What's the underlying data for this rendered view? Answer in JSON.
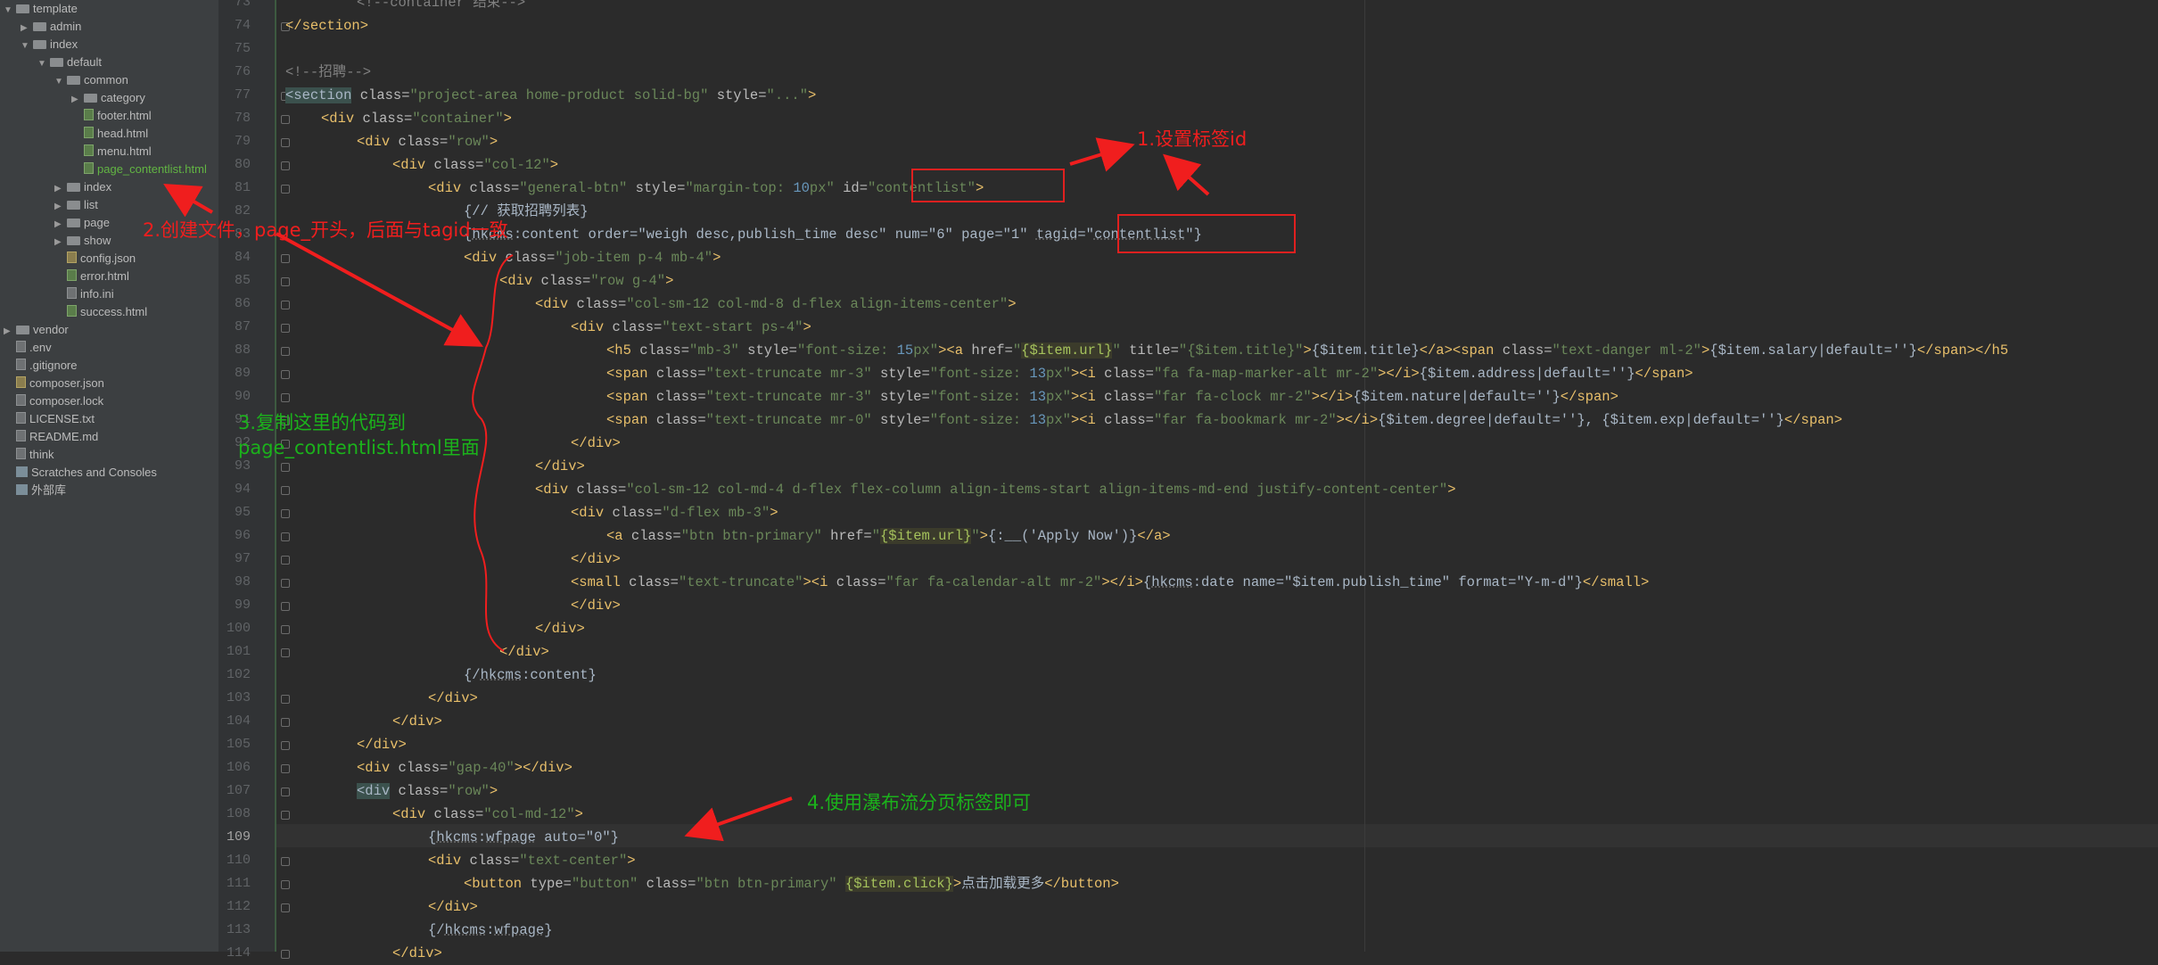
{
  "project_tree": [
    {
      "depth": 0,
      "arrow": "▼",
      "icon": "folder",
      "label": "template"
    },
    {
      "depth": 1,
      "arrow": "▶",
      "icon": "folder",
      "label": "admin"
    },
    {
      "depth": 1,
      "arrow": "▼",
      "icon": "folder",
      "label": "index"
    },
    {
      "depth": 2,
      "arrow": "▼",
      "icon": "folder",
      "label": "default"
    },
    {
      "depth": 3,
      "arrow": "▼",
      "icon": "folder",
      "label": "common"
    },
    {
      "depth": 4,
      "arrow": "▶",
      "icon": "folder",
      "label": "category"
    },
    {
      "depth": 4,
      "arrow": "",
      "icon": "html",
      "label": "footer.html"
    },
    {
      "depth": 4,
      "arrow": "",
      "icon": "html",
      "label": "head.html"
    },
    {
      "depth": 4,
      "arrow": "",
      "icon": "html",
      "label": "menu.html"
    },
    {
      "depth": 4,
      "arrow": "",
      "icon": "html",
      "label": "page_contentlist.html",
      "highlight": true
    },
    {
      "depth": 3,
      "arrow": "▶",
      "icon": "folder",
      "label": "index"
    },
    {
      "depth": 3,
      "arrow": "▶",
      "icon": "folder",
      "label": "list"
    },
    {
      "depth": 3,
      "arrow": "▶",
      "icon": "folder",
      "label": "page"
    },
    {
      "depth": 3,
      "arrow": "▶",
      "icon": "folder",
      "label": "show"
    },
    {
      "depth": 3,
      "arrow": "",
      "icon": "json",
      "label": "config.json"
    },
    {
      "depth": 3,
      "arrow": "",
      "icon": "html",
      "label": "error.html"
    },
    {
      "depth": 3,
      "arrow": "",
      "icon": "file",
      "label": "info.ini"
    },
    {
      "depth": 3,
      "arrow": "",
      "icon": "html",
      "label": "success.html"
    },
    {
      "depth": 0,
      "arrow": "▶",
      "icon": "folder",
      "label": "vendor"
    },
    {
      "depth": 0,
      "arrow": "",
      "icon": "file",
      "label": ".env"
    },
    {
      "depth": 0,
      "arrow": "",
      "icon": "file",
      "label": ".gitignore"
    },
    {
      "depth": 0,
      "arrow": "",
      "icon": "json",
      "label": "composer.json"
    },
    {
      "depth": 0,
      "arrow": "",
      "icon": "file",
      "label": "composer.lock"
    },
    {
      "depth": 0,
      "arrow": "",
      "icon": "file",
      "label": "LICENSE.txt"
    },
    {
      "depth": 0,
      "arrow": "",
      "icon": "file",
      "label": "README.md"
    },
    {
      "depth": 0,
      "arrow": "",
      "icon": "file",
      "label": "think"
    },
    {
      "depth": -1,
      "arrow": "",
      "icon": "ext",
      "label": "Scratches and Consoles"
    },
    {
      "depth": -1,
      "arrow": "",
      "icon": "ext",
      "label": "外部库"
    }
  ],
  "current_line": 109,
  "code_lines": [
    {
      "n": 73,
      "indent": 2,
      "tokens": [
        [
          "cm",
          "<!--container 结束-->"
        ]
      ]
    },
    {
      "n": 74,
      "indent": 0,
      "tokens": [
        [
          "tag",
          "</section>"
        ]
      ]
    },
    {
      "n": 75,
      "indent": 0,
      "tokens": []
    },
    {
      "n": 76,
      "indent": 0,
      "tokens": [
        [
          "cm",
          "<!--招聘-->"
        ]
      ]
    },
    {
      "n": 77,
      "indent": 0,
      "tokens": [
        [
          "hltag",
          "<section"
        ],
        [
          "attr",
          " class="
        ],
        [
          "val",
          "\"project-area home-product solid-bg\""
        ],
        [
          "attr",
          " style="
        ],
        [
          "val",
          "\"...\""
        ],
        [
          "tag",
          ">"
        ]
      ]
    },
    {
      "n": 78,
      "indent": 1,
      "tokens": [
        [
          "tag",
          "<div"
        ],
        [
          "attr",
          " class="
        ],
        [
          "val",
          "\"container\""
        ],
        [
          "tag",
          ">"
        ]
      ]
    },
    {
      "n": 79,
      "indent": 2,
      "tokens": [
        [
          "tag",
          "<div"
        ],
        [
          "attr",
          " class="
        ],
        [
          "val",
          "\"row\""
        ],
        [
          "tag",
          ">"
        ]
      ]
    },
    {
      "n": 80,
      "indent": 3,
      "tokens": [
        [
          "tag",
          "<div"
        ],
        [
          "attr",
          " class="
        ],
        [
          "val",
          "\"col-12\""
        ],
        [
          "tag",
          ">"
        ]
      ]
    },
    {
      "n": 81,
      "indent": 4,
      "tokens": [
        [
          "tag",
          "<div"
        ],
        [
          "attr",
          " class="
        ],
        [
          "val",
          "\"general-btn\""
        ],
        [
          "attr",
          " style="
        ],
        [
          "val",
          "\"margin-top: "
        ],
        [
          "num",
          "10"
        ],
        [
          "val",
          "px\""
        ],
        [
          "attr",
          " id="
        ],
        [
          "val",
          "\"contentlist\""
        ],
        [
          "tag",
          ">"
        ]
      ]
    },
    {
      "n": 82,
      "indent": 5,
      "tokens": [
        [
          "txt",
          "{// 获取招聘列表}"
        ]
      ]
    },
    {
      "n": 83,
      "indent": 5,
      "tokens": [
        [
          "txt",
          "{"
        ],
        [
          "ns",
          "hkcms"
        ],
        [
          "txt",
          ":content order=\"weigh desc,publish_time desc\" num=\"6\" page=\"1\" "
        ],
        [
          "ns",
          "tagid"
        ],
        [
          "txt",
          "=\""
        ],
        [
          "ns",
          "contentlist"
        ],
        [
          "txt",
          "\"}"
        ]
      ]
    },
    {
      "n": 84,
      "indent": 5,
      "tokens": [
        [
          "tag",
          "<div"
        ],
        [
          "attr",
          " class="
        ],
        [
          "val",
          "\"job-item p-4 mb-4\""
        ],
        [
          "tag",
          ">"
        ]
      ]
    },
    {
      "n": 85,
      "indent": 6,
      "tokens": [
        [
          "tag",
          "<div"
        ],
        [
          "attr",
          " class="
        ],
        [
          "val",
          "\"row g-4\""
        ],
        [
          "tag",
          ">"
        ]
      ]
    },
    {
      "n": 86,
      "indent": 7,
      "tokens": [
        [
          "tag",
          "<div"
        ],
        [
          "attr",
          " class="
        ],
        [
          "val",
          "\"col-sm-12 col-md-8 d-flex align-items-center\""
        ],
        [
          "tag",
          ">"
        ]
      ]
    },
    {
      "n": 87,
      "indent": 8,
      "tokens": [
        [
          "tag",
          "<div"
        ],
        [
          "attr",
          " class="
        ],
        [
          "val",
          "\"text-start ps-4\""
        ],
        [
          "tag",
          ">"
        ]
      ]
    },
    {
      "n": 88,
      "indent": 9,
      "tokens": [
        [
          "tag",
          "<h5"
        ],
        [
          "attr",
          " class="
        ],
        [
          "val",
          "\"mb-3\""
        ],
        [
          "attr",
          " style="
        ],
        [
          "val",
          "\"font-size: "
        ],
        [
          "num",
          "15"
        ],
        [
          "val",
          "px\""
        ],
        [
          "tag",
          ">"
        ],
        [
          "tag",
          "<a"
        ],
        [
          "attr",
          " href="
        ],
        [
          "val",
          "\""
        ],
        [
          "hl",
          "{$item.url}"
        ],
        [
          "val",
          "\""
        ],
        [
          "attr",
          " title="
        ],
        [
          "val",
          "\"{$item.title}\""
        ],
        [
          "tag",
          ">"
        ],
        [
          "txt",
          "{$item.title}"
        ],
        [
          "tag",
          "</a><span"
        ],
        [
          "attr",
          " class="
        ],
        [
          "val",
          "\"text-danger ml-2\""
        ],
        [
          "tag",
          ">"
        ],
        [
          "txt",
          "{$item.salary|default=''}"
        ],
        [
          "tag",
          "</span></h5"
        ]
      ]
    },
    {
      "n": 89,
      "indent": 9,
      "tokens": [
        [
          "tag",
          "<span"
        ],
        [
          "attr",
          " class="
        ],
        [
          "val",
          "\"text-truncate mr-3\""
        ],
        [
          "attr",
          " style="
        ],
        [
          "val",
          "\"font-size: "
        ],
        [
          "num",
          "13"
        ],
        [
          "val",
          "px\""
        ],
        [
          "tag",
          ">"
        ],
        [
          "tag",
          "<i"
        ],
        [
          "attr",
          " class="
        ],
        [
          "val",
          "\"fa fa-map-marker-alt mr-2\""
        ],
        [
          "tag",
          "></i>"
        ],
        [
          "txt",
          "{$item.address|default=''}"
        ],
        [
          "tag",
          "</span>"
        ]
      ]
    },
    {
      "n": 90,
      "indent": 9,
      "tokens": [
        [
          "tag",
          "<span"
        ],
        [
          "attr",
          " class="
        ],
        [
          "val",
          "\"text-truncate mr-3\""
        ],
        [
          "attr",
          " style="
        ],
        [
          "val",
          "\"font-size: "
        ],
        [
          "num",
          "13"
        ],
        [
          "val",
          "px\""
        ],
        [
          "tag",
          ">"
        ],
        [
          "tag",
          "<i"
        ],
        [
          "attr",
          " class="
        ],
        [
          "val",
          "\"far fa-clock mr-2\""
        ],
        [
          "tag",
          "></i>"
        ],
        [
          "txt",
          "{$item.nature|default=''}"
        ],
        [
          "tag",
          "</span>"
        ]
      ]
    },
    {
      "n": 91,
      "indent": 9,
      "tokens": [
        [
          "tag",
          "<span"
        ],
        [
          "attr",
          " class="
        ],
        [
          "val",
          "\"text-truncate mr-0\""
        ],
        [
          "attr",
          " style="
        ],
        [
          "val",
          "\"font-size: "
        ],
        [
          "num",
          "13"
        ],
        [
          "val",
          "px\""
        ],
        [
          "tag",
          ">"
        ],
        [
          "tag",
          "<i"
        ],
        [
          "attr",
          " class="
        ],
        [
          "val",
          "\"far fa-bookmark mr-2\""
        ],
        [
          "tag",
          "></i>"
        ],
        [
          "txt",
          "{$item.degree|default=''}, {$item.exp|default=''}"
        ],
        [
          "tag",
          "</span>"
        ]
      ]
    },
    {
      "n": 92,
      "indent": 8,
      "tokens": [
        [
          "tag",
          "</div>"
        ]
      ]
    },
    {
      "n": 93,
      "indent": 7,
      "tokens": [
        [
          "tag",
          "</div>"
        ]
      ]
    },
    {
      "n": 94,
      "indent": 7,
      "tokens": [
        [
          "tag",
          "<div"
        ],
        [
          "attr",
          " class="
        ],
        [
          "val",
          "\"col-sm-12 col-md-4 d-flex flex-column align-items-start align-items-md-end justify-content-center\""
        ],
        [
          "tag",
          ">"
        ]
      ]
    },
    {
      "n": 95,
      "indent": 8,
      "tokens": [
        [
          "tag",
          "<div"
        ],
        [
          "attr",
          " class="
        ],
        [
          "val",
          "\"d-flex mb-3\""
        ],
        [
          "tag",
          ">"
        ]
      ]
    },
    {
      "n": 96,
      "indent": 9,
      "tokens": [
        [
          "tag",
          "<a"
        ],
        [
          "attr",
          " class="
        ],
        [
          "val",
          "\"btn btn-primary\""
        ],
        [
          "attr",
          " href="
        ],
        [
          "val",
          "\""
        ],
        [
          "hl",
          "{$item.url}"
        ],
        [
          "val",
          "\""
        ],
        [
          "tag",
          ">"
        ],
        [
          "txt",
          "{:__('Apply Now')}"
        ],
        [
          "tag",
          "</a>"
        ]
      ]
    },
    {
      "n": 97,
      "indent": 8,
      "tokens": [
        [
          "tag",
          "</div>"
        ]
      ]
    },
    {
      "n": 98,
      "indent": 8,
      "tokens": [
        [
          "tag",
          "<small"
        ],
        [
          "attr",
          " class="
        ],
        [
          "val",
          "\"text-truncate\""
        ],
        [
          "tag",
          ">"
        ],
        [
          "tag",
          "<i"
        ],
        [
          "attr",
          " class="
        ],
        [
          "val",
          "\"far fa-calendar-alt mr-2\""
        ],
        [
          "tag",
          "></i>"
        ],
        [
          "txt",
          "{"
        ],
        [
          "ns",
          "hkcms"
        ],
        [
          "txt",
          ":date name=\"$item.publish_time\" format=\"Y-m-d\"}"
        ],
        [
          "tag",
          "</small>"
        ]
      ]
    },
    {
      "n": 99,
      "indent": 8,
      "tokens": [
        [
          "tag",
          "</div>"
        ]
      ]
    },
    {
      "n": 100,
      "indent": 7,
      "tokens": [
        [
          "tag",
          "</div>"
        ]
      ]
    },
    {
      "n": 101,
      "indent": 6,
      "tokens": [
        [
          "tag",
          "</div>"
        ]
      ]
    },
    {
      "n": 102,
      "indent": 5,
      "tokens": [
        [
          "txt",
          "{/"
        ],
        [
          "ns",
          "hkcms"
        ],
        [
          "txt",
          ":content}"
        ]
      ]
    },
    {
      "n": 103,
      "indent": 4,
      "tokens": [
        [
          "tag",
          "</div>"
        ]
      ]
    },
    {
      "n": 104,
      "indent": 3,
      "tokens": [
        [
          "tag",
          "</div>"
        ]
      ]
    },
    {
      "n": 105,
      "indent": 2,
      "tokens": [
        [
          "tag",
          "</div>"
        ]
      ]
    },
    {
      "n": 106,
      "indent": 2,
      "tokens": [
        [
          "tag",
          "<div"
        ],
        [
          "attr",
          " class="
        ],
        [
          "val",
          "\"gap-40\""
        ],
        [
          "tag",
          "></div>"
        ]
      ]
    },
    {
      "n": 107,
      "indent": 2,
      "tokens": [
        [
          "hltag",
          "<div"
        ],
        [
          "attr",
          " class="
        ],
        [
          "val",
          "\"row\""
        ],
        [
          "tag",
          ">"
        ]
      ]
    },
    {
      "n": 108,
      "indent": 3,
      "tokens": [
        [
          "tag",
          "<div"
        ],
        [
          "attr",
          " class="
        ],
        [
          "val",
          "\"col-md-12\""
        ],
        [
          "tag",
          ">"
        ]
      ]
    },
    {
      "n": 109,
      "indent": 4,
      "tokens": [
        [
          "txt",
          "{"
        ],
        [
          "ns",
          "hkcms"
        ],
        [
          "txt",
          ":"
        ],
        [
          "ns",
          "wfpage"
        ],
        [
          "txt",
          " auto=\"0\"}"
        ]
      ]
    },
    {
      "n": 110,
      "indent": 4,
      "tokens": [
        [
          "tag",
          "<div"
        ],
        [
          "attr",
          " class="
        ],
        [
          "val",
          "\"text-center\""
        ],
        [
          "tag",
          ">"
        ]
      ]
    },
    {
      "n": 111,
      "indent": 5,
      "tokens": [
        [
          "tag",
          "<button"
        ],
        [
          "attr",
          " type="
        ],
        [
          "val",
          "\"button\""
        ],
        [
          "attr",
          " class="
        ],
        [
          "val",
          "\"btn btn-primary\""
        ],
        [
          "attr",
          " "
        ],
        [
          "hl",
          "{$item.click}"
        ],
        [
          "tag",
          ">"
        ],
        [
          "txt",
          "点击加载更多"
        ],
        [
          "tag",
          "</button>"
        ]
      ]
    },
    {
      "n": 112,
      "indent": 4,
      "tokens": [
        [
          "tag",
          "</div>"
        ]
      ]
    },
    {
      "n": 113,
      "indent": 4,
      "tokens": [
        [
          "txt",
          "{/"
        ],
        [
          "ns",
          "hkcms"
        ],
        [
          "txt",
          ":"
        ],
        [
          "ns",
          "wfpage"
        ],
        [
          "txt",
          "}"
        ]
      ]
    },
    {
      "n": 114,
      "indent": 3,
      "tokens": [
        [
          "tag",
          "</div>"
        ]
      ]
    }
  ],
  "annotations": {
    "a1": "1.设置标签id",
    "a2": "2.创建文件，page_开头，后面与tagid一致",
    "a3_line1": "3.复制这里的代码到",
    "a3_line2": "page_contentlist.html里面",
    "a4": "4.使用瀑布流分页标签即可"
  },
  "colors": {
    "annotation_red": "#f01e1e",
    "annotation_green": "#1bb21b",
    "editor_bg": "#2b2b2b",
    "sidebar_bg": "#3c3f41"
  }
}
